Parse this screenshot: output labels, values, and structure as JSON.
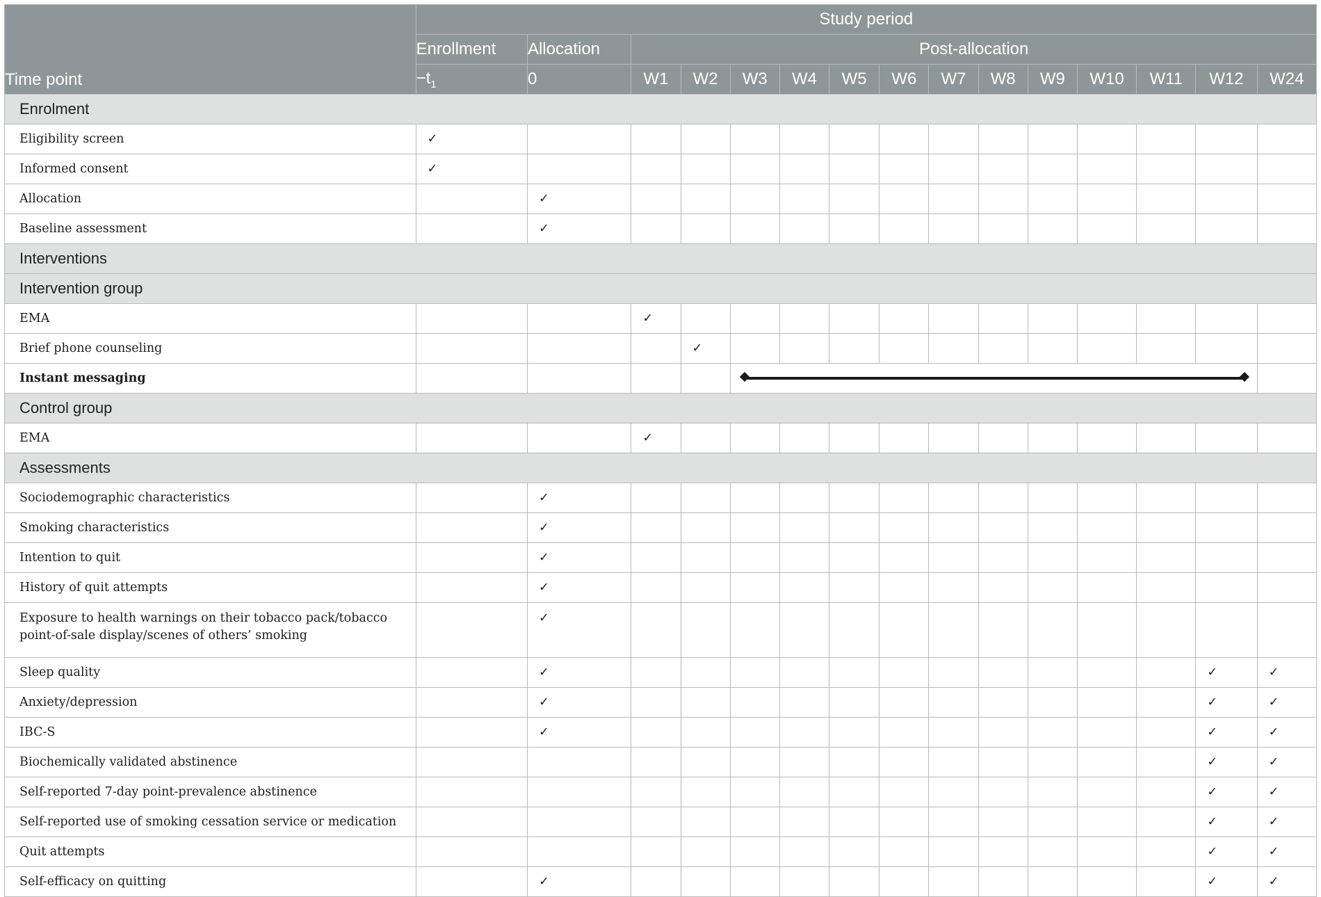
{
  "header": {
    "time_point_label": "Time point",
    "study_period": "Study period",
    "enrollment": "Enrollment",
    "enrollment_time_base": "−t",
    "enrollment_time_sub": "1",
    "allocation": "Allocation",
    "allocation_time": "0",
    "post_allocation": "Post-allocation",
    "weeks": [
      "W1",
      "W2",
      "W3",
      "W4",
      "W5",
      "W6",
      "W7",
      "W8",
      "W9",
      "W10",
      "W11",
      "W12",
      "W24"
    ]
  },
  "check_glyph": "✓",
  "rows": [
    {
      "type": "section",
      "label": "Enrolment"
    },
    {
      "type": "row",
      "label": "Eligibility screen",
      "marks": [
        1,
        0,
        0,
        0,
        0,
        0,
        0,
        0,
        0,
        0,
        0,
        0,
        0,
        0,
        0
      ]
    },
    {
      "type": "row",
      "label": "Informed consent",
      "marks": [
        1,
        0,
        0,
        0,
        0,
        0,
        0,
        0,
        0,
        0,
        0,
        0,
        0,
        0,
        0
      ]
    },
    {
      "type": "row",
      "label": "Allocation",
      "marks": [
        0,
        1,
        0,
        0,
        0,
        0,
        0,
        0,
        0,
        0,
        0,
        0,
        0,
        0,
        0
      ]
    },
    {
      "type": "row",
      "label": "Baseline assessment",
      "marks": [
        0,
        1,
        0,
        0,
        0,
        0,
        0,
        0,
        0,
        0,
        0,
        0,
        0,
        0,
        0
      ]
    },
    {
      "type": "section",
      "label": "Interventions"
    },
    {
      "type": "section",
      "label": "Intervention group"
    },
    {
      "type": "row",
      "label": "EMA",
      "marks": [
        0,
        0,
        1,
        0,
        0,
        0,
        0,
        0,
        0,
        0,
        0,
        0,
        0,
        0,
        0
      ]
    },
    {
      "type": "row",
      "label": "Brief phone counseling",
      "marks": [
        0,
        0,
        0,
        1,
        0,
        0,
        0,
        0,
        0,
        0,
        0,
        0,
        0,
        0,
        0
      ]
    },
    {
      "type": "span",
      "label": "Instant messaging",
      "bold": true,
      "span_from": "W3",
      "span_to": "W12"
    },
    {
      "type": "section",
      "label": "Control group"
    },
    {
      "type": "row",
      "label": "EMA",
      "marks": [
        0,
        0,
        1,
        0,
        0,
        0,
        0,
        0,
        0,
        0,
        0,
        0,
        0,
        0,
        0
      ]
    },
    {
      "type": "section",
      "label": "Assessments"
    },
    {
      "type": "row",
      "label": "Sociodemographic characteristics",
      "marks": [
        0,
        1,
        0,
        0,
        0,
        0,
        0,
        0,
        0,
        0,
        0,
        0,
        0,
        0,
        0
      ]
    },
    {
      "type": "row",
      "label": "Smoking characteristics",
      "marks": [
        0,
        1,
        0,
        0,
        0,
        0,
        0,
        0,
        0,
        0,
        0,
        0,
        0,
        0,
        0
      ]
    },
    {
      "type": "row",
      "label": "Intention to quit",
      "marks": [
        0,
        1,
        0,
        0,
        0,
        0,
        0,
        0,
        0,
        0,
        0,
        0,
        0,
        0,
        0
      ]
    },
    {
      "type": "row",
      "label": "History of quit attempts",
      "marks": [
        0,
        1,
        0,
        0,
        0,
        0,
        0,
        0,
        0,
        0,
        0,
        0,
        0,
        0,
        0
      ]
    },
    {
      "type": "row",
      "tall": true,
      "label_lines": [
        "Exposure to health warnings on their tobacco pack/tobacco",
        "point-of-sale display/scenes of others’ smoking"
      ],
      "marks": [
        0,
        1,
        0,
        0,
        0,
        0,
        0,
        0,
        0,
        0,
        0,
        0,
        0,
        0,
        0
      ]
    },
    {
      "type": "row",
      "label": "Sleep quality",
      "marks": [
        0,
        1,
        0,
        0,
        0,
        0,
        0,
        0,
        0,
        0,
        0,
        0,
        0,
        1,
        1
      ]
    },
    {
      "type": "row",
      "label": "Anxiety/depression",
      "marks": [
        0,
        1,
        0,
        0,
        0,
        0,
        0,
        0,
        0,
        0,
        0,
        0,
        0,
        1,
        1
      ]
    },
    {
      "type": "row",
      "label": "IBC-S",
      "marks": [
        0,
        1,
        0,
        0,
        0,
        0,
        0,
        0,
        0,
        0,
        0,
        0,
        0,
        1,
        1
      ]
    },
    {
      "type": "row",
      "label": "Biochemically validated abstinence",
      "marks": [
        0,
        0,
        0,
        0,
        0,
        0,
        0,
        0,
        0,
        0,
        0,
        0,
        0,
        1,
        1
      ]
    },
    {
      "type": "row",
      "label": "Self-reported 7-day point-prevalence abstinence",
      "marks": [
        0,
        0,
        0,
        0,
        0,
        0,
        0,
        0,
        0,
        0,
        0,
        0,
        0,
        1,
        1
      ]
    },
    {
      "type": "row",
      "label": "Self-reported use of smoking cessation service or medication",
      "marks": [
        0,
        0,
        0,
        0,
        0,
        0,
        0,
        0,
        0,
        0,
        0,
        0,
        0,
        1,
        1
      ]
    },
    {
      "type": "row",
      "label": "Quit attempts",
      "marks": [
        0,
        0,
        0,
        0,
        0,
        0,
        0,
        0,
        0,
        0,
        0,
        0,
        0,
        1,
        1
      ]
    },
    {
      "type": "row",
      "label": "Self-efficacy on quitting",
      "marks": [
        0,
        1,
        0,
        0,
        0,
        0,
        0,
        0,
        0,
        0,
        0,
        0,
        0,
        1,
        1
      ]
    }
  ]
}
